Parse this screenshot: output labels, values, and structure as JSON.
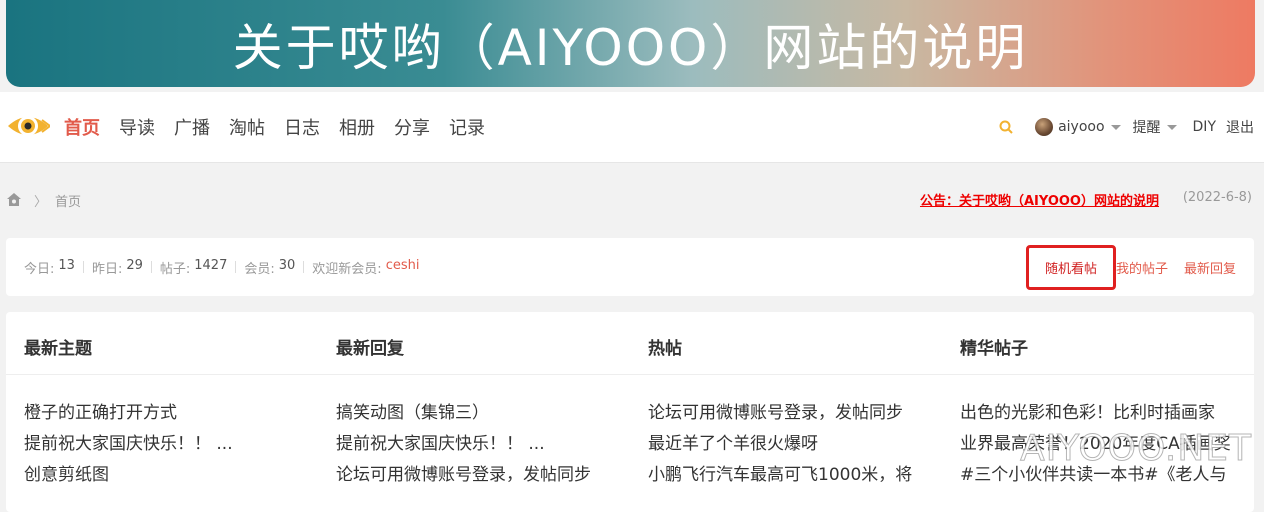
{
  "banner": {
    "text": "关于哎哟（AIYOOO）网站的说明"
  },
  "nav": {
    "items": [
      {
        "label": "首页",
        "active": true
      },
      {
        "label": "导读"
      },
      {
        "label": "广播"
      },
      {
        "label": "淘帖"
      },
      {
        "label": "日志"
      },
      {
        "label": "相册"
      },
      {
        "label": "分享"
      },
      {
        "label": "记录"
      }
    ]
  },
  "user": {
    "name": "aiyooo",
    "remind_label": "提醒",
    "diy_label": "DIY",
    "logout_label": "退出"
  },
  "breadcrumb": {
    "home": "首页",
    "sep": "〉"
  },
  "notice": {
    "text": "公告：关于哎哟（AIYOOO）网站的说明",
    "date": "(2022-6-8)"
  },
  "stats": {
    "today_label": "今日:",
    "today": "13",
    "yesterday_label": "昨日:",
    "yesterday": "29",
    "posts_label": "帖子:",
    "posts": "1427",
    "members_label": "会员:",
    "members": "30",
    "welcome_label": "欢迎新会员:",
    "new_member": "ceshi",
    "random_label": "随机看帖",
    "my_posts_label": "我的帖子",
    "latest_reply_label": "最新回复"
  },
  "columns": [
    {
      "title": "最新主题",
      "items": [
        "橙子的正确打开方式",
        "提前祝大家国庆快乐！！ ...",
        "创意剪纸图"
      ]
    },
    {
      "title": "最新回复",
      "items": [
        "搞笑动图（集锦三）",
        "提前祝大家国庆快乐！！ ...",
        "论坛可用微博账号登录，发帖同步"
      ]
    },
    {
      "title": "热帖",
      "items": [
        "论坛可用微博账号登录，发帖同步",
        "最近羊了个羊很火爆呀",
        "小鹏飞行汽车最高可飞1000米，将"
      ]
    },
    {
      "title": "精华帖子",
      "items": [
        "出色的光影和色彩！比利时插画家",
        "业界最高荣誉！2020年度CA插画奖",
        "#三个小伙伴共读一本书#《老人与"
      ]
    }
  ],
  "watermark": "AIYOOO.NET",
  "colors": {
    "accent": "#e25b4b",
    "highlight_box": "#e02020",
    "notice": "#e00000"
  }
}
